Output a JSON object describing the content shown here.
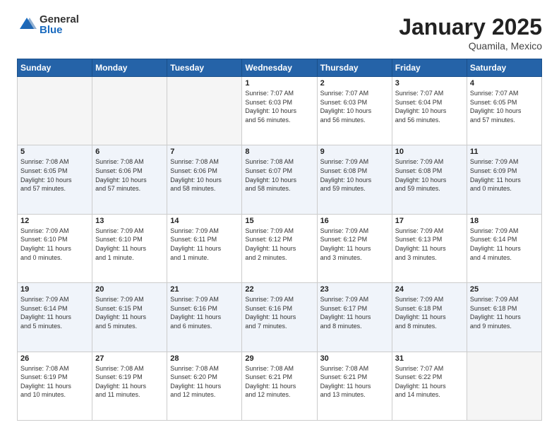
{
  "logo": {
    "general": "General",
    "blue": "Blue"
  },
  "title": {
    "month": "January 2025",
    "location": "Quamila, Mexico"
  },
  "headers": [
    "Sunday",
    "Monday",
    "Tuesday",
    "Wednesday",
    "Thursday",
    "Friday",
    "Saturday"
  ],
  "weeks": [
    [
      {
        "day": "",
        "info": ""
      },
      {
        "day": "",
        "info": ""
      },
      {
        "day": "",
        "info": ""
      },
      {
        "day": "1",
        "info": "Sunrise: 7:07 AM\nSunset: 6:03 PM\nDaylight: 10 hours\nand 56 minutes."
      },
      {
        "day": "2",
        "info": "Sunrise: 7:07 AM\nSunset: 6:03 PM\nDaylight: 10 hours\nand 56 minutes."
      },
      {
        "day": "3",
        "info": "Sunrise: 7:07 AM\nSunset: 6:04 PM\nDaylight: 10 hours\nand 56 minutes."
      },
      {
        "day": "4",
        "info": "Sunrise: 7:07 AM\nSunset: 6:05 PM\nDaylight: 10 hours\nand 57 minutes."
      }
    ],
    [
      {
        "day": "5",
        "info": "Sunrise: 7:08 AM\nSunset: 6:05 PM\nDaylight: 10 hours\nand 57 minutes."
      },
      {
        "day": "6",
        "info": "Sunrise: 7:08 AM\nSunset: 6:06 PM\nDaylight: 10 hours\nand 57 minutes."
      },
      {
        "day": "7",
        "info": "Sunrise: 7:08 AM\nSunset: 6:06 PM\nDaylight: 10 hours\nand 58 minutes."
      },
      {
        "day": "8",
        "info": "Sunrise: 7:08 AM\nSunset: 6:07 PM\nDaylight: 10 hours\nand 58 minutes."
      },
      {
        "day": "9",
        "info": "Sunrise: 7:09 AM\nSunset: 6:08 PM\nDaylight: 10 hours\nand 59 minutes."
      },
      {
        "day": "10",
        "info": "Sunrise: 7:09 AM\nSunset: 6:08 PM\nDaylight: 10 hours\nand 59 minutes."
      },
      {
        "day": "11",
        "info": "Sunrise: 7:09 AM\nSunset: 6:09 PM\nDaylight: 11 hours\nand 0 minutes."
      }
    ],
    [
      {
        "day": "12",
        "info": "Sunrise: 7:09 AM\nSunset: 6:10 PM\nDaylight: 11 hours\nand 0 minutes."
      },
      {
        "day": "13",
        "info": "Sunrise: 7:09 AM\nSunset: 6:10 PM\nDaylight: 11 hours\nand 1 minute."
      },
      {
        "day": "14",
        "info": "Sunrise: 7:09 AM\nSunset: 6:11 PM\nDaylight: 11 hours\nand 1 minute."
      },
      {
        "day": "15",
        "info": "Sunrise: 7:09 AM\nSunset: 6:12 PM\nDaylight: 11 hours\nand 2 minutes."
      },
      {
        "day": "16",
        "info": "Sunrise: 7:09 AM\nSunset: 6:12 PM\nDaylight: 11 hours\nand 3 minutes."
      },
      {
        "day": "17",
        "info": "Sunrise: 7:09 AM\nSunset: 6:13 PM\nDaylight: 11 hours\nand 3 minutes."
      },
      {
        "day": "18",
        "info": "Sunrise: 7:09 AM\nSunset: 6:14 PM\nDaylight: 11 hours\nand 4 minutes."
      }
    ],
    [
      {
        "day": "19",
        "info": "Sunrise: 7:09 AM\nSunset: 6:14 PM\nDaylight: 11 hours\nand 5 minutes."
      },
      {
        "day": "20",
        "info": "Sunrise: 7:09 AM\nSunset: 6:15 PM\nDaylight: 11 hours\nand 5 minutes."
      },
      {
        "day": "21",
        "info": "Sunrise: 7:09 AM\nSunset: 6:16 PM\nDaylight: 11 hours\nand 6 minutes."
      },
      {
        "day": "22",
        "info": "Sunrise: 7:09 AM\nSunset: 6:16 PM\nDaylight: 11 hours\nand 7 minutes."
      },
      {
        "day": "23",
        "info": "Sunrise: 7:09 AM\nSunset: 6:17 PM\nDaylight: 11 hours\nand 8 minutes."
      },
      {
        "day": "24",
        "info": "Sunrise: 7:09 AM\nSunset: 6:18 PM\nDaylight: 11 hours\nand 8 minutes."
      },
      {
        "day": "25",
        "info": "Sunrise: 7:09 AM\nSunset: 6:18 PM\nDaylight: 11 hours\nand 9 minutes."
      }
    ],
    [
      {
        "day": "26",
        "info": "Sunrise: 7:08 AM\nSunset: 6:19 PM\nDaylight: 11 hours\nand 10 minutes."
      },
      {
        "day": "27",
        "info": "Sunrise: 7:08 AM\nSunset: 6:19 PM\nDaylight: 11 hours\nand 11 minutes."
      },
      {
        "day": "28",
        "info": "Sunrise: 7:08 AM\nSunset: 6:20 PM\nDaylight: 11 hours\nand 12 minutes."
      },
      {
        "day": "29",
        "info": "Sunrise: 7:08 AM\nSunset: 6:21 PM\nDaylight: 11 hours\nand 12 minutes."
      },
      {
        "day": "30",
        "info": "Sunrise: 7:08 AM\nSunset: 6:21 PM\nDaylight: 11 hours\nand 13 minutes."
      },
      {
        "day": "31",
        "info": "Sunrise: 7:07 AM\nSunset: 6:22 PM\nDaylight: 11 hours\nand 14 minutes."
      },
      {
        "day": "",
        "info": ""
      }
    ]
  ]
}
